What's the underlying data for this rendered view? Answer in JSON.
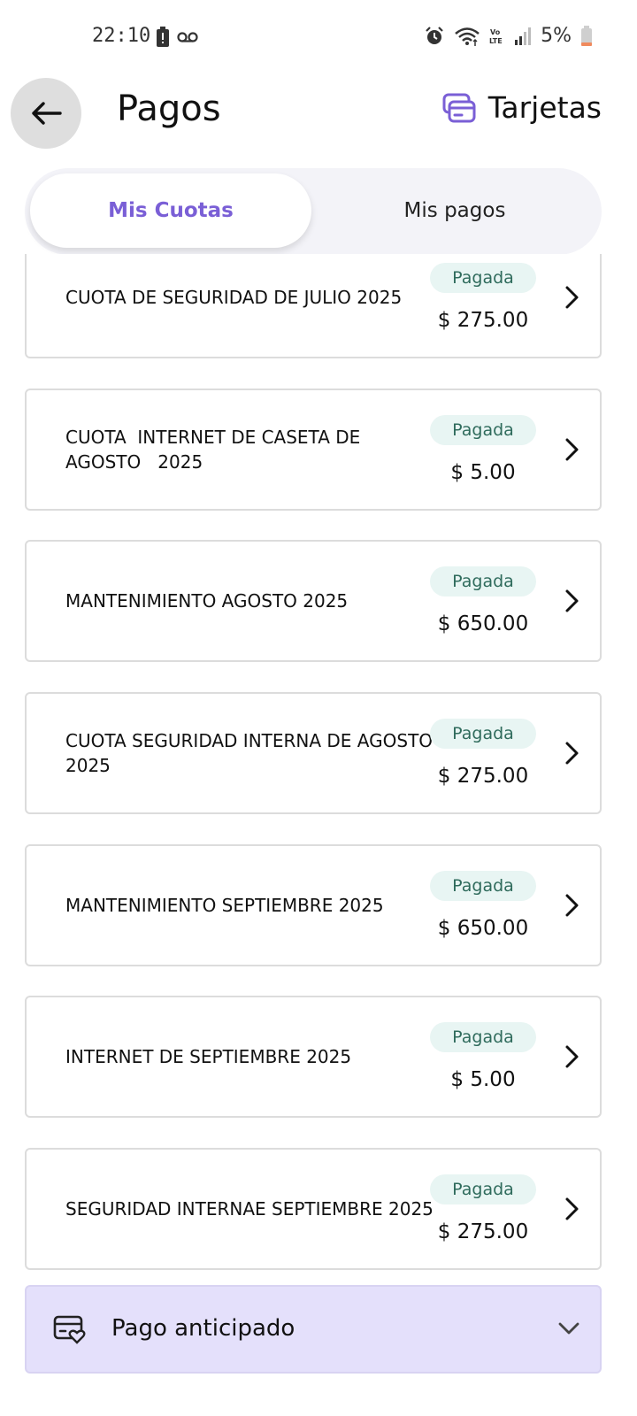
{
  "status_bar": {
    "time": "22:10",
    "battery": "5%",
    "icons": [
      "battery-alert-icon",
      "voicemail-icon",
      "alarm-icon",
      "wifi-icon",
      "volte-icon",
      "signal-icon",
      "battery-low-icon"
    ]
  },
  "header": {
    "back_icon": "arrow-left-icon",
    "title": "Pagos",
    "cards_icon": "credit-cards-icon",
    "cards_label": "Tarjetas"
  },
  "tabs": [
    {
      "label": "Mis Cuotas",
      "active": true
    },
    {
      "label": "Mis pagos",
      "active": false
    }
  ],
  "colors": {
    "accent": "#7a5fd6",
    "badge_bg": "#e8f5f3",
    "badge_text": "#2f6b5c",
    "accordion_bg": "#e4e0fb"
  },
  "fees": [
    {
      "title": "CUOTA DE SEGURIDAD DE JULIO 2025",
      "status": "Pagada",
      "amount": "$ 275.00"
    },
    {
      "title": "CUOTA  INTERNET DE CASETA DE AGOSTO   2025",
      "status": "Pagada",
      "amount": "$ 5.00"
    },
    {
      "title": "MANTENIMIENTO AGOSTO 2025",
      "status": "Pagada",
      "amount": "$ 650.00"
    },
    {
      "title": "CUOTA SEGURIDAD INTERNA DE AGOSTO 2025",
      "status": "Pagada",
      "amount": "$ 275.00"
    },
    {
      "title": "MANTENIMIENTO SEPTIEMBRE 2025",
      "status": "Pagada",
      "amount": "$ 650.00"
    },
    {
      "title": "INTERNET DE SEPTIEMBRE 2025",
      "status": "Pagada",
      "amount": "$ 5.00"
    },
    {
      "title": "SEGURIDAD INTERNAE SEPTIEMBRE 2025",
      "status": "Pagada",
      "amount": "$ 275.00"
    }
  ],
  "accordion": {
    "icon": "card-heart-icon",
    "label": "Pago anticipado",
    "chevron_icon": "chevron-down-icon"
  }
}
